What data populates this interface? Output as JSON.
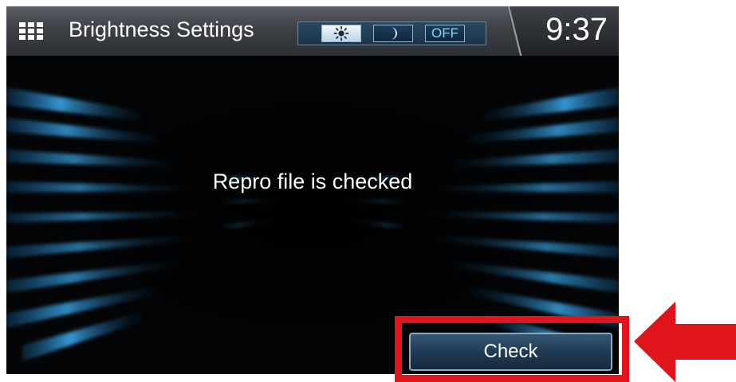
{
  "header": {
    "title": "Brightness Settings",
    "modes": [
      {
        "name": "day",
        "icon": "sun-icon",
        "selected": true
      },
      {
        "name": "night",
        "icon": "moon-icon",
        "selected": false
      },
      {
        "name": "off",
        "label": "OFF",
        "selected": false
      }
    ],
    "clock": "9:37"
  },
  "main": {
    "message": "Repro file is checked",
    "check_button_label": "Check"
  },
  "annotation": {
    "highlight_color": "#e0141b",
    "arrow_icon": "left-arrow-icon"
  }
}
